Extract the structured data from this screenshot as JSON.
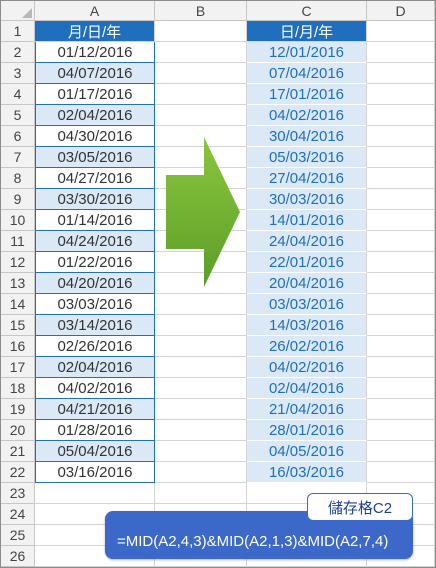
{
  "columns": [
    "A",
    "B",
    "C",
    "D"
  ],
  "rows": [
    "1",
    "2",
    "3",
    "4",
    "5",
    "6",
    "7",
    "8",
    "9",
    "10",
    "11",
    "12",
    "13",
    "14",
    "15",
    "16",
    "17",
    "18",
    "19",
    "20",
    "21",
    "22",
    "23",
    "24",
    "25",
    "26"
  ],
  "colA_header": "月/日/年",
  "colC_header": "日/月/年",
  "colA_values": [
    "01/12/2016",
    "04/07/2016",
    "01/17/2016",
    "02/04/2016",
    "04/30/2016",
    "03/05/2016",
    "04/27/2016",
    "03/30/2016",
    "01/14/2016",
    "04/24/2016",
    "01/22/2016",
    "04/20/2016",
    "03/03/2016",
    "03/14/2016",
    "02/26/2016",
    "02/04/2016",
    "04/02/2016",
    "04/21/2016",
    "01/28/2016",
    "05/04/2016",
    "03/16/2016"
  ],
  "colC_values": [
    "12/01/2016",
    "07/04/2016",
    "17/01/2016",
    "04/02/2016",
    "30/04/2016",
    "05/03/2016",
    "27/04/2016",
    "30/03/2016",
    "14/01/2016",
    "24/04/2016",
    "22/01/2016",
    "20/04/2016",
    "03/03/2016",
    "14/03/2016",
    "26/02/2016",
    "04/02/2016",
    "02/04/2016",
    "21/04/2016",
    "28/01/2016",
    "04/05/2016",
    "16/03/2016"
  ],
  "callout": {
    "label": "儲存格C2",
    "formula": "=MID(A2,4,3)&MID(A2,1,3)&MID(A2,7,4)"
  },
  "colors": {
    "header_blue": "#1f6fbe",
    "light_blue": "#dbe8f6",
    "arrow_green": "#6fb22f",
    "callout_blue": "#3b68c9"
  },
  "arrow_icon": "right-arrow-icon"
}
